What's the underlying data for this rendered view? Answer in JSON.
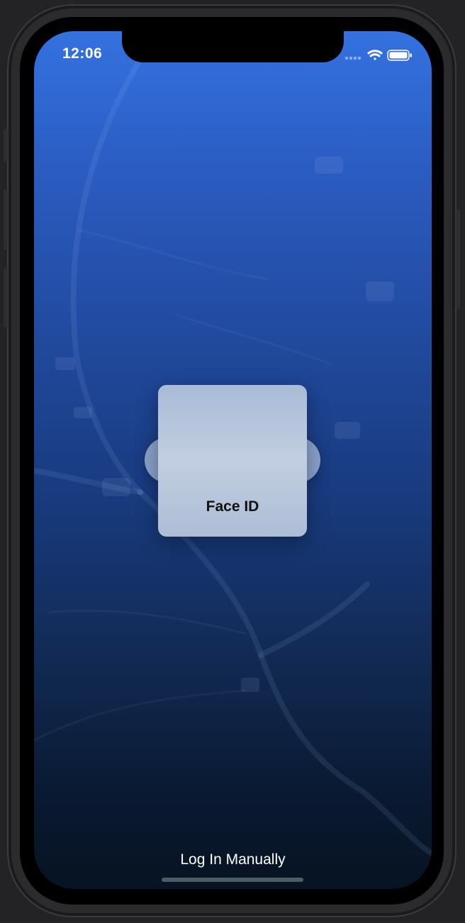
{
  "status_bar": {
    "time": "12:06",
    "icons": [
      "signal-icon",
      "wifi-icon",
      "battery-icon"
    ]
  },
  "faceid": {
    "label": "Face ID"
  },
  "login_manual": "Log In Manually",
  "colors": {
    "accent_top": "#3472e0",
    "accent_bottom": "#061322",
    "text": "#ffffff"
  }
}
